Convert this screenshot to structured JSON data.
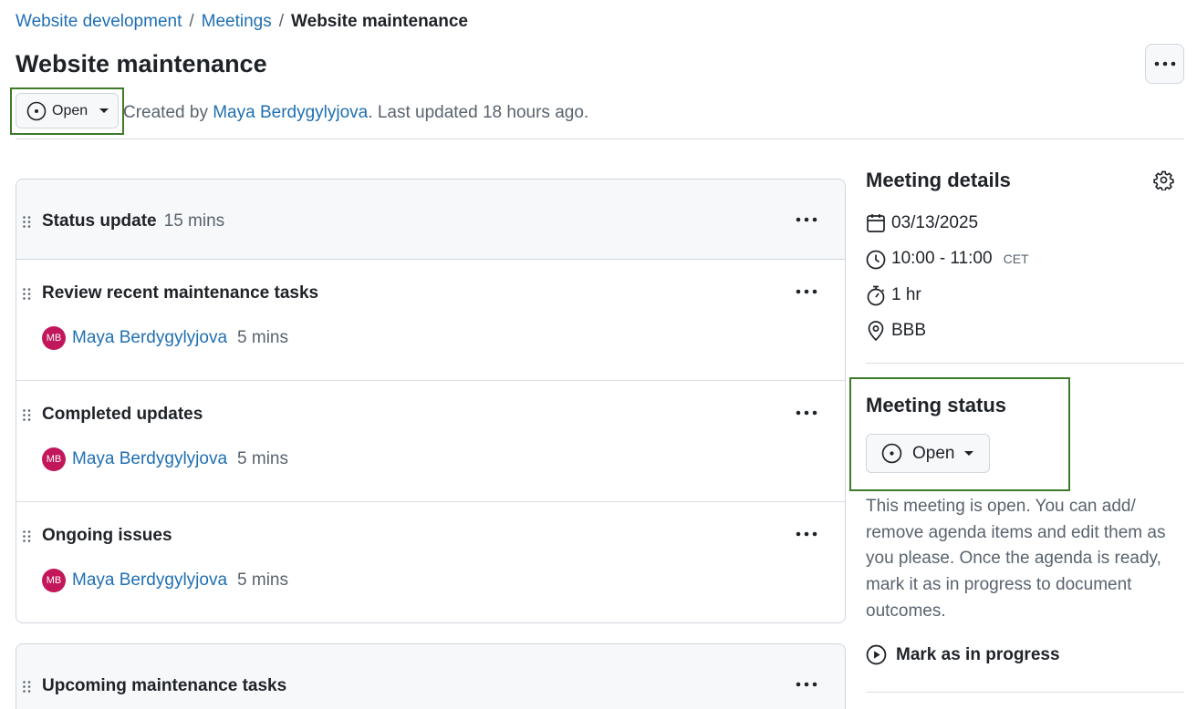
{
  "breadcrumb": {
    "items": [
      "Website development",
      "Meetings"
    ],
    "separator": "/",
    "current": "Website maintenance"
  },
  "page": {
    "title": "Website maintenance",
    "status_label": "Open",
    "created_prefix": "Created by",
    "author": "Maya Berdygylyjova",
    "updated_text": ". Last updated 18 hours ago."
  },
  "agenda": {
    "section": {
      "title": "Status update",
      "duration": "15 mins"
    },
    "items": [
      {
        "title": "Review recent maintenance tasks",
        "initials": "MB",
        "owner": "Maya Berdygylyjova",
        "duration": "5 mins"
      },
      {
        "title": "Completed updates",
        "initials": "MB",
        "owner": "Maya Berdygylyjova",
        "duration": "5 mins"
      },
      {
        "title": "Ongoing issues",
        "initials": "MB",
        "owner": "Maya Berdygylyjova",
        "duration": "5 mins"
      }
    ],
    "section2": {
      "title": "Upcoming maintenance tasks"
    }
  },
  "sidebar": {
    "details_title": "Meeting details",
    "date": "03/13/2025",
    "time": "10:00 - 11:00",
    "timezone": "CET",
    "duration": "1 hr",
    "location": "BBB",
    "status_title": "Meeting status",
    "status_label": "Open",
    "description": "This meeting is open. You can add/ remove agenda items and edit them as you please. Once the agenda is ready, mark it as in progress to document outcomes.",
    "mark_label": "Mark as in progress"
  },
  "colors": {
    "accent_link": "#1f6fb2",
    "highlight_frame": "#3d7a2a",
    "avatar_bg": "#c2185b"
  },
  "icons": [
    "more-icon",
    "status-open-icon",
    "caret-down-icon",
    "drag-handle-icon",
    "gear-icon",
    "calendar-icon",
    "clock-icon",
    "stopwatch-icon",
    "location-pin-icon",
    "play-circle-icon"
  ]
}
